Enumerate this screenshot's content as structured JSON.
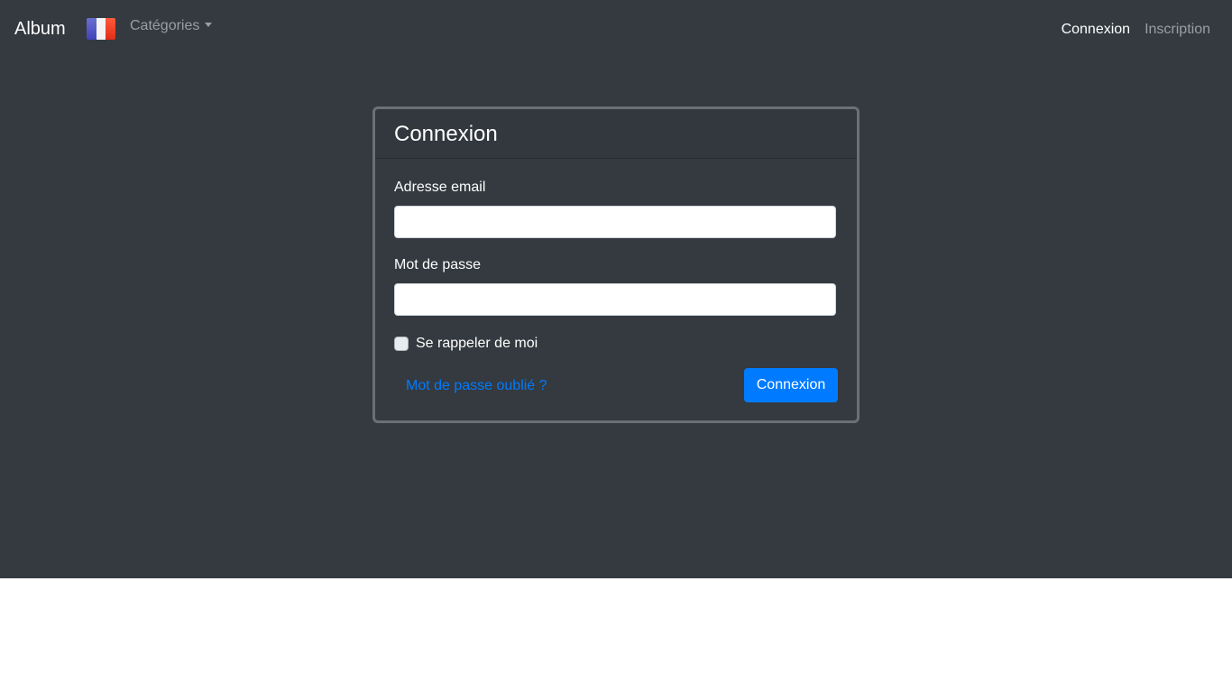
{
  "navbar": {
    "brand": "Album",
    "flag_icon": "france-flag-icon",
    "categories_label": "Catégories",
    "login_link": "Connexion",
    "register_link": "Inscription"
  },
  "login_card": {
    "title": "Connexion",
    "email_label": "Adresse email",
    "email_value": "",
    "email_placeholder": "",
    "password_label": "Mot de passe",
    "password_value": "",
    "password_placeholder": "",
    "remember_label": "Se rappeler de moi",
    "remember_checked": false,
    "forgot_link": "Mot de passe oublié ?",
    "submit_label": "Connexion"
  },
  "colors": {
    "background": "#343a40",
    "primary": "#007bff",
    "text": "#ffffff"
  }
}
